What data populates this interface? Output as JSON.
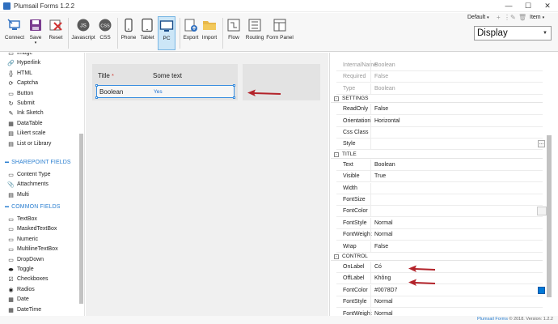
{
  "window": {
    "title": "Plumsail Forms 1.2.2",
    "controls": [
      "—",
      "☐",
      "✕"
    ]
  },
  "ribbon": {
    "connect": "Connect",
    "save": "Save",
    "reset": "Reset",
    "javascript": "Javascript",
    "css": "CSS",
    "js_badge": "JS",
    "css_badge": "CSS",
    "phone": "Phone",
    "tablet": "Tablet",
    "pc": "PC",
    "export": "Export",
    "import": "Import",
    "flow": "Flow",
    "routing": "Routing",
    "form_panel": "Form Panel",
    "language": "Default",
    "item": "Item",
    "display": "Display",
    "colors": {
      "accent": "#2b7fd0",
      "active_bg": "#cce6f7"
    }
  },
  "toolbox": {
    "items_top": [
      {
        "icon": "image-icon",
        "glyph": "▭",
        "label": "Image"
      },
      {
        "icon": "hyperlink-icon",
        "glyph": "🔗",
        "label": "Hyperlink"
      },
      {
        "icon": "html-icon",
        "glyph": "{}",
        "label": "HTML"
      },
      {
        "icon": "captcha-icon",
        "glyph": "⟳",
        "label": "Captcha"
      },
      {
        "icon": "button-icon",
        "glyph": "▭",
        "label": "Button"
      },
      {
        "icon": "submit-icon",
        "glyph": "↻",
        "label": "Submit"
      },
      {
        "icon": "ink-sketch-icon",
        "glyph": "✎",
        "label": "Ink Sketch"
      },
      {
        "icon": "datatable-icon",
        "glyph": "▦",
        "label": "DataTable"
      },
      {
        "icon": "likert-icon",
        "glyph": "▤",
        "label": "Likert scale"
      },
      {
        "icon": "list-icon",
        "glyph": "▤",
        "label": "List or Library"
      }
    ],
    "sharepoint_heading": "SHAREPOINT FIELDS",
    "items_sharepoint": [
      {
        "icon": "content-type-icon",
        "glyph": "▭",
        "label": "Content Type"
      },
      {
        "icon": "attachments-icon",
        "glyph": "📎",
        "label": "Attachments"
      },
      {
        "icon": "multi-icon",
        "glyph": "▤",
        "label": "Multi"
      }
    ],
    "common_heading": "COMMON FIELDS",
    "items_common": [
      {
        "icon": "textbox-icon",
        "glyph": "▭",
        "label": "TextBox"
      },
      {
        "icon": "masked-textbox-icon",
        "glyph": "▭",
        "label": "MaskedTextBox"
      },
      {
        "icon": "numeric-icon",
        "glyph": "▭",
        "label": "Numeric"
      },
      {
        "icon": "multiline-icon",
        "glyph": "▭",
        "label": "MultilineTextBox"
      },
      {
        "icon": "dropdown-icon",
        "glyph": "▭",
        "label": "DropDown"
      },
      {
        "icon": "toggle-icon",
        "glyph": "⬬",
        "label": "Toggle"
      },
      {
        "icon": "checkboxes-icon",
        "glyph": "☑",
        "label": "Checkboxes"
      },
      {
        "icon": "radios-icon",
        "glyph": "◉",
        "label": "Radios"
      },
      {
        "icon": "date-icon",
        "glyph": "▦",
        "label": "Date"
      },
      {
        "icon": "datetime-icon",
        "glyph": "▦",
        "label": "DateTime"
      }
    ]
  },
  "canvas": {
    "header_title": "Title",
    "required_mark": "*",
    "header_value": "Some text",
    "field_label": "Boolean",
    "field_value": "Yes"
  },
  "properties": {
    "top_rows": [
      {
        "key": "InternalName",
        "value": "Boolean"
      },
      {
        "key": "Required",
        "value": "False"
      },
      {
        "key": "Type",
        "value": "Boolean"
      }
    ],
    "settings_title": "SETTINGS",
    "settings_rows": [
      {
        "key": "ReadOnly",
        "value": "False"
      },
      {
        "key": "Orientation",
        "value": "Horizontal"
      },
      {
        "key": "Css Class",
        "value": ""
      },
      {
        "key": "Style",
        "value": ""
      }
    ],
    "title_title": "TITLE",
    "title_rows": [
      {
        "key": "Text",
        "value": "Boolean"
      },
      {
        "key": "Visible",
        "value": "True"
      },
      {
        "key": "Width",
        "value": ""
      },
      {
        "key": "FontSize",
        "value": ""
      },
      {
        "key": "FontColor",
        "value": ""
      },
      {
        "key": "FontStyle",
        "value": "Normal"
      },
      {
        "key": "FontWeight",
        "value": "Normal"
      },
      {
        "key": "Wrap",
        "value": "False"
      }
    ],
    "control_title": "CONTROL",
    "control_rows": [
      {
        "key": "OnLabel",
        "value": "Có"
      },
      {
        "key": "OffLabel",
        "value": "Không"
      },
      {
        "key": "FontColor",
        "value": "#0078D7"
      },
      {
        "key": "FontStyle",
        "value": "Normal"
      },
      {
        "key": "FontWeight",
        "value": "Normal"
      }
    ],
    "style_button": "...",
    "collapse_glyph": "-"
  },
  "footer": {
    "brand": "Plumsail Forms",
    "text": "© 2018. Version: 1.2.2"
  }
}
